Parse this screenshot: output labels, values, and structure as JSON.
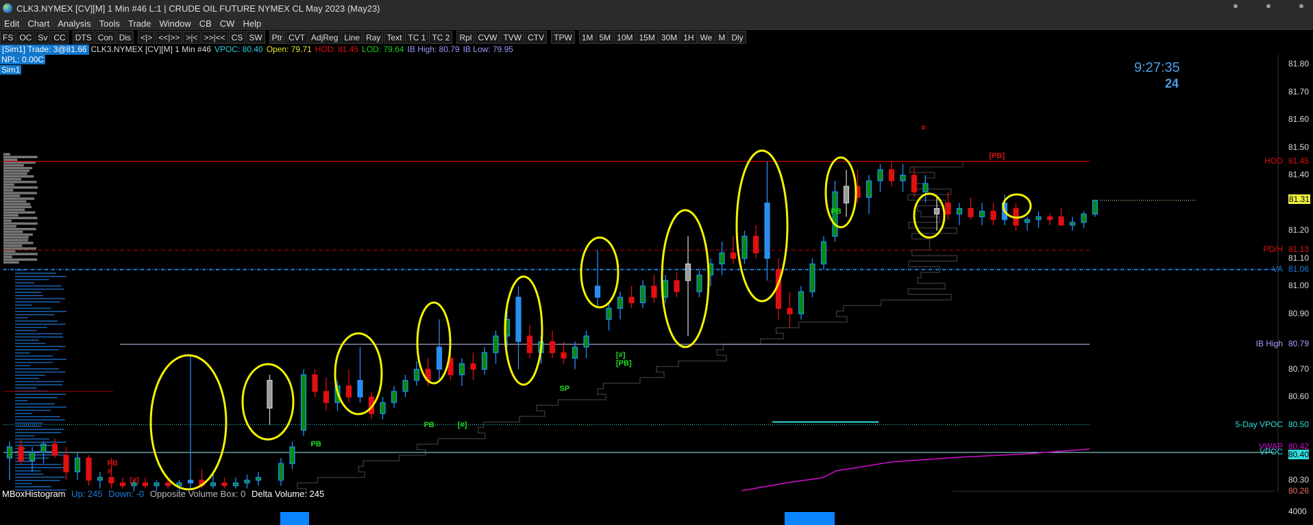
{
  "window": {
    "title": "CLK3.NYMEX [CV][M]  1 Min   #46 L:1 | CRUDE OIL FUTURE NYMEX CL May 2023 (May23)"
  },
  "menu": [
    "Edit",
    "Chart",
    "Analysis",
    "Tools",
    "Trade",
    "Window",
    "CB",
    "CW",
    "Help"
  ],
  "toolbar": [
    [
      "FS",
      "OC",
      "Sv",
      "CC"
    ],
    [
      "DTS",
      "Con",
      "Dis"
    ],
    [
      "<|>",
      "<<|>>",
      ">|<",
      ">>|<<",
      "CS",
      "SW"
    ],
    [
      "Ptr",
      "CVT",
      "AdjReg",
      "Line",
      "Ray",
      "Text",
      "TC 1",
      "TC 2"
    ],
    [
      "Rpl",
      "CVW",
      "TVW",
      "CTV"
    ],
    [
      "TPW"
    ],
    [
      "1M",
      "5M",
      "10M",
      "15M",
      "30M",
      "1H",
      "We",
      "M",
      "Dly"
    ]
  ],
  "info": {
    "sim_trade": "[Sim1]  Trade: 3@81.66",
    "symbol": "CLK3.NYMEX [CV][M]  1 Min   #46",
    "vpoc": "VPOC: 80.40",
    "open": "Open: 79.71",
    "hod": "HOD: 81.45",
    "lod": "LOD: 79.64",
    "ib_high": "IB High: 80.79",
    "ib_low": "IB Low: 79.95",
    "npl": "NPL: 0.00C",
    "sim": "Sim1"
  },
  "clock": {
    "time": "9:27:35",
    "count": "24"
  },
  "axis": {
    "ticks": [
      "81.80",
      "81.70",
      "81.60",
      "81.50",
      "81.40",
      "81.20",
      "81.10",
      "81.00",
      "80.90",
      "80.70",
      "80.60",
      "80.30"
    ],
    "markers": [
      {
        "label": "HOD",
        "value": "81.45",
        "price": 81.45,
        "color": "#e01010"
      },
      {
        "label": "PD/H",
        "value": "81.13",
        "price": 81.13,
        "color": "#e01010"
      },
      {
        "label": "VA",
        "value": "81.06",
        "price": 81.06,
        "color": "#1e7fe0"
      },
      {
        "label": "IB High",
        "value": "80.79",
        "price": 80.79,
        "color": "#a0a0ff"
      },
      {
        "label": "5-Day VPOC",
        "value": "80.50",
        "price": 80.5,
        "color": "#30e0e0"
      },
      {
        "label": "VWAP",
        "value": "80.42",
        "price": 80.42,
        "color": "#d010d0"
      },
      {
        "label": "VPOC",
        "value": "80.40",
        "price": 80.4,
        "color": "#30e0e0"
      }
    ],
    "last_price": "81.31",
    "low_tag": "80.26",
    "volume_tick": "4000"
  },
  "status": {
    "name": "MBoxHistogram",
    "up": "Up: 245",
    "down": "Down: -0",
    "opp": "Opposite Volume Box: 0",
    "delta": "Delta Volume: 245"
  },
  "signals": [
    {
      "t": "#",
      "c": "#e01010",
      "p": 81.57,
      "i": 81
    },
    {
      "t": "[PB]",
      "c": "#e01010",
      "p": 81.47,
      "i": 87
    },
    {
      "t": "PB",
      "c": "#20e020",
      "p": 81.27,
      "i": 73
    },
    {
      "t": "[#]",
      "c": "#20e020",
      "p": 80.75,
      "i": 54
    },
    {
      "t": "[PB]",
      "c": "#20e020",
      "p": 80.72,
      "i": 54
    },
    {
      "t": "SP",
      "c": "#20e020",
      "p": 80.63,
      "i": 49
    },
    {
      "t": "PB",
      "c": "#20e020",
      "p": 80.5,
      "i": 37
    },
    {
      "t": "[#]",
      "c": "#20e020",
      "p": 80.5,
      "i": 40
    },
    {
      "t": "PB",
      "c": "#20e020",
      "p": 80.43,
      "i": 27
    },
    {
      "t": "PB",
      "c": "#e01010",
      "p": 80.36,
      "i": 9
    },
    {
      "t": "#",
      "c": "#e01010",
      "p": 80.33,
      "i": 9
    },
    {
      "t": "[#]",
      "c": "#e01010",
      "p": 80.3,
      "i": 11
    }
  ],
  "chart_data": {
    "type": "candlestick",
    "ylim": [
      80.25,
      81.85
    ],
    "candles": [
      [
        80.38,
        80.44,
        80.3,
        80.42
      ],
      [
        80.42,
        80.45,
        80.36,
        80.37
      ],
      [
        80.37,
        80.42,
        80.33,
        80.4
      ],
      [
        80.4,
        80.44,
        80.36,
        80.43
      ],
      [
        80.43,
        80.45,
        80.38,
        80.39
      ],
      [
        80.39,
        80.42,
        80.3,
        80.33
      ],
      [
        80.33,
        80.4,
        80.3,
        80.38
      ],
      [
        80.38,
        80.39,
        80.28,
        80.3
      ],
      [
        80.3,
        80.33,
        80.27,
        80.31
      ],
      [
        80.31,
        80.38,
        80.27,
        80.29
      ],
      [
        80.29,
        80.31,
        80.27,
        80.28
      ],
      [
        80.28,
        80.3,
        80.26,
        80.29
      ],
      [
        80.29,
        80.31,
        80.27,
        80.28
      ],
      [
        80.28,
        80.3,
        80.26,
        80.29
      ],
      [
        80.29,
        80.31,
        80.27,
        80.28
      ],
      [
        80.28,
        80.3,
        80.26,
        80.29
      ],
      [
        80.29,
        80.75,
        80.27,
        80.3,
        "b"
      ],
      [
        80.3,
        80.34,
        80.27,
        80.28
      ],
      [
        80.28,
        80.33,
        80.27,
        80.29
      ],
      [
        80.29,
        80.31,
        80.27,
        80.28
      ],
      [
        80.28,
        80.31,
        80.27,
        80.29
      ],
      [
        80.29,
        80.32,
        80.27,
        80.3
      ],
      [
        80.3,
        80.33,
        80.28,
        80.31
      ],
      [
        80.56,
        80.68,
        80.5,
        80.66,
        "g"
      ],
      [
        80.3,
        80.38,
        80.28,
        80.36
      ],
      [
        80.36,
        80.44,
        80.34,
        80.42
      ],
      [
        80.48,
        80.7,
        80.46,
        80.68
      ],
      [
        80.68,
        80.7,
        80.6,
        80.62
      ],
      [
        80.62,
        80.67,
        80.55,
        80.58
      ],
      [
        80.58,
        80.66,
        80.55,
        80.64
      ],
      [
        80.64,
        80.7,
        80.58,
        80.6
      ],
      [
        80.6,
        80.78,
        80.58,
        80.66,
        "b"
      ],
      [
        80.6,
        80.62,
        80.52,
        80.54
      ],
      [
        80.54,
        80.6,
        80.52,
        80.58
      ],
      [
        80.58,
        80.64,
        80.56,
        80.62
      ],
      [
        80.62,
        80.68,
        80.6,
        80.66
      ],
      [
        80.66,
        80.73,
        80.64,
        80.7
      ],
      [
        80.7,
        80.74,
        80.64,
        80.66
      ],
      [
        80.7,
        80.88,
        80.66,
        80.78,
        "b"
      ],
      [
        80.74,
        80.76,
        80.66,
        80.68
      ],
      [
        80.68,
        80.74,
        80.64,
        80.72
      ],
      [
        80.72,
        80.76,
        80.66,
        80.7
      ],
      [
        80.7,
        80.78,
        80.68,
        80.76
      ],
      [
        80.76,
        80.84,
        80.72,
        80.82
      ],
      [
        80.82,
        80.92,
        80.78,
        80.88
      ],
      [
        80.96,
        81.0,
        80.7,
        80.8,
        "b"
      ],
      [
        80.82,
        80.86,
        80.74,
        80.76
      ],
      [
        80.76,
        80.82,
        80.72,
        80.8
      ],
      [
        80.8,
        80.84,
        80.74,
        80.76
      ],
      [
        80.76,
        80.8,
        80.72,
        80.74
      ],
      [
        80.74,
        80.8,
        80.7,
        80.78
      ],
      [
        80.78,
        80.84,
        80.74,
        80.82
      ],
      [
        80.96,
        81.13,
        80.92,
        81.0,
        "b"
      ],
      [
        80.88,
        80.94,
        80.84,
        80.92
      ],
      [
        80.92,
        80.98,
        80.88,
        80.96
      ],
      [
        80.96,
        81.0,
        80.92,
        80.94
      ],
      [
        80.94,
        81.02,
        80.92,
        81.0
      ],
      [
        81.0,
        81.04,
        80.94,
        80.96
      ],
      [
        80.96,
        81.04,
        80.94,
        81.02
      ],
      [
        81.02,
        81.05,
        80.96,
        80.98
      ],
      [
        81.08,
        81.18,
        80.82,
        81.02,
        "g"
      ],
      [
        80.98,
        81.06,
        80.96,
        81.04
      ],
      [
        81.04,
        81.1,
        81.0,
        81.08
      ],
      [
        81.08,
        81.16,
        81.04,
        81.12
      ],
      [
        81.12,
        81.18,
        81.08,
        81.1
      ],
      [
        81.1,
        81.2,
        81.08,
        81.18
      ],
      [
        81.18,
        81.22,
        81.1,
        81.12
      ],
      [
        81.1,
        81.45,
        81.02,
        81.3,
        "b"
      ],
      [
        81.06,
        81.1,
        80.88,
        80.92
      ],
      [
        80.92,
        80.98,
        80.85,
        80.9
      ],
      [
        80.9,
        81.0,
        80.88,
        80.98
      ],
      [
        80.98,
        81.1,
        80.96,
        81.08
      ],
      [
        81.08,
        81.18,
        81.06,
        81.16
      ],
      [
        81.18,
        81.38,
        81.16,
        81.34
      ],
      [
        81.3,
        81.42,
        81.25,
        81.36,
        "g"
      ],
      [
        81.36,
        81.42,
        81.3,
        81.32
      ],
      [
        81.32,
        81.4,
        81.26,
        81.38
      ],
      [
        81.38,
        81.44,
        81.34,
        81.42
      ],
      [
        81.42,
        81.45,
        81.36,
        81.38
      ],
      [
        81.38,
        81.44,
        81.34,
        81.4
      ],
      [
        81.4,
        81.43,
        81.32,
        81.34
      ],
      [
        81.34,
        81.4,
        81.3,
        81.37
      ],
      [
        81.26,
        81.32,
        81.2,
        81.28,
        "g"
      ],
      [
        81.3,
        81.34,
        81.24,
        81.26
      ],
      [
        81.26,
        81.3,
        81.22,
        81.28
      ],
      [
        81.28,
        81.32,
        81.24,
        81.25
      ],
      [
        81.25,
        81.3,
        81.22,
        81.27
      ],
      [
        81.27,
        81.3,
        81.22,
        81.24
      ],
      [
        81.24,
        81.33,
        81.22,
        81.3,
        "b"
      ],
      [
        81.28,
        81.3,
        81.2,
        81.22
      ],
      [
        81.23,
        81.25,
        81.2,
        81.24
      ],
      [
        81.24,
        81.27,
        81.21,
        81.25
      ],
      [
        81.25,
        81.26,
        81.22,
        81.24
      ],
      [
        81.25,
        81.28,
        81.22,
        81.22
      ],
      [
        81.22,
        81.25,
        81.2,
        81.23
      ],
      [
        81.23,
        81.27,
        81.21,
        81.26
      ],
      [
        81.26,
        81.31,
        81.25,
        81.31
      ]
    ]
  },
  "colors": {
    "up_body": "#0a8a0a",
    "up_border": "#1e90ff",
    "down": "#e01010",
    "blue": "#2a8ef0",
    "grey": "#9a9a9a",
    "annotation": "#f5f500"
  }
}
